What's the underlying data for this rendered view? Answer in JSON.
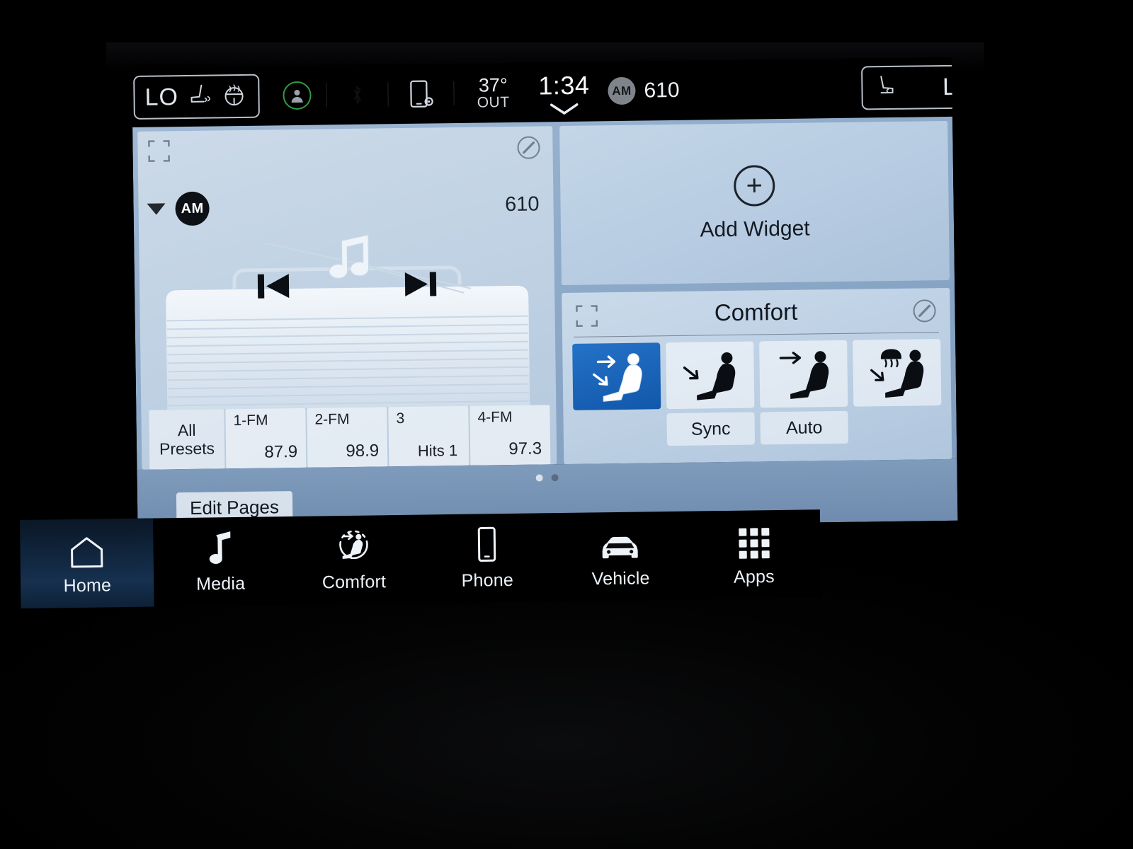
{
  "statusbar": {
    "left_climate": {
      "value": "LO",
      "icons": [
        "heated-seat-icon",
        "heated-steering-wheel-icon"
      ]
    },
    "right_climate": {
      "value": "LO",
      "icons": [
        "heated-seat-icon"
      ]
    },
    "profile_icon": "user-profile-icon",
    "phone_settings_icon": "phone-settings-icon",
    "temperature": {
      "value": "37°",
      "label": "OUT"
    },
    "clock": {
      "time": "1:34",
      "chevron": "chevron-down-icon"
    },
    "source": {
      "band": "AM",
      "frequency": "610"
    }
  },
  "media_widget": {
    "expand_icon": "expand-widget-icon",
    "edit_icon": "edit-pencil-icon",
    "band_badge": "AM",
    "band_caret": "caret-down-icon",
    "frequency": "610",
    "album_art": "vintage-radio-artwork",
    "prev_icon": "previous-track-icon",
    "next_icon": "next-track-icon",
    "presets": [
      {
        "name": "all-presets",
        "line1": "All",
        "line2": "Presets"
      },
      {
        "name": "preset-1",
        "label": "1-FM",
        "value": "87.9"
      },
      {
        "name": "preset-2",
        "label": "2-FM",
        "value": "98.9"
      },
      {
        "name": "preset-3",
        "label": "3",
        "value": "Hits 1"
      },
      {
        "name": "preset-4",
        "label": "4-FM",
        "value": "97.3"
      }
    ]
  },
  "add_widget": {
    "plus": "+",
    "label": "Add Widget"
  },
  "comfort_widget": {
    "expand_icon": "expand-widget-icon",
    "title": "Comfort",
    "edit_icon": "edit-pencil-icon",
    "modes": [
      {
        "name": "airflow-face-and-feet",
        "icon": "seat-face-feet-icon",
        "selected": true,
        "sublabel": ""
      },
      {
        "name": "airflow-feet",
        "icon": "seat-feet-icon",
        "selected": false,
        "sublabel": "Sync"
      },
      {
        "name": "airflow-face",
        "icon": "seat-face-icon",
        "selected": false,
        "sublabel": "Auto"
      },
      {
        "name": "airflow-defrost-and-feet",
        "icon": "seat-defrost-feet-icon",
        "selected": false,
        "sublabel": ""
      }
    ]
  },
  "page_strip": {
    "edit_pages_label": "Edit Pages",
    "dots": [
      {
        "active": false
      },
      {
        "active": true
      }
    ]
  },
  "navbar": {
    "items": [
      {
        "name": "nav-home",
        "label": "Home",
        "icon": "home-icon",
        "active": true
      },
      {
        "name": "nav-media",
        "label": "Media",
        "icon": "music-note-icon",
        "active": false
      },
      {
        "name": "nav-comfort",
        "label": "Comfort",
        "icon": "seat-comfort-icon",
        "active": false
      },
      {
        "name": "nav-phone",
        "label": "Phone",
        "icon": "phone-icon",
        "active": false
      },
      {
        "name": "nav-vehicle",
        "label": "Vehicle",
        "icon": "car-icon",
        "active": false
      },
      {
        "name": "nav-apps",
        "label": "Apps",
        "icon": "apps-grid-icon",
        "active": false
      }
    ]
  },
  "colors": {
    "accent_blue": "#1257aa",
    "panel_light": "#c6d7e8",
    "background_blue": "#8fabca",
    "status_green": "#2f9c3e",
    "screen_black": "#000000"
  }
}
